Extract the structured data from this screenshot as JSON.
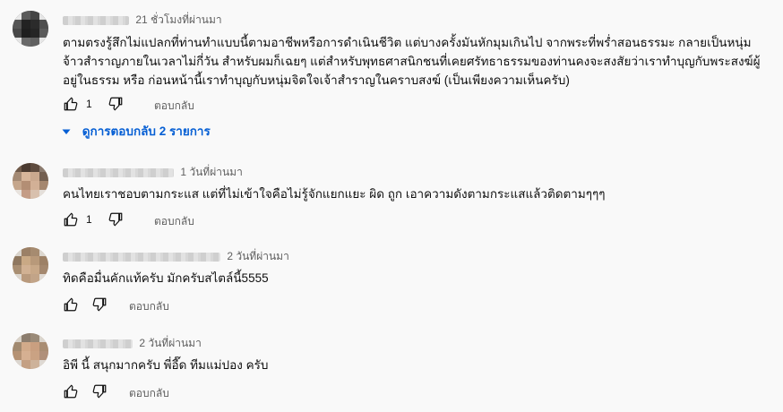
{
  "comments": [
    {
      "time": "21 ชั่วโมงที่ผ่านมา",
      "text": "ตามตรงรู้สึกไม่แปลกที่ท่านทำแบบนี้ตามอาชีพหรือการดำเนินชีวิต  แต่บางครั้งมันหักมุมเกินไป  จากพระที่พร่ำสอนธรรมะ กลายเป็นหนุ่มจ้าวสำราญภายในเวลาไม่กี่วัน  สำหรับผมก็เฉยๆ  แต่สำหรับพุทธศาสนิกชนที่เคยศรัทธาธรรมของท่านคงจะสงสัยว่าเราทำบุญกับพระสงฆ์ผู้อยู่ในธรรม หรือ ก่อนหน้านี้เราทำบุญกับหนุ่มจิตใจเจ้าสำราญในคราบสงฆ์  (เป็นเพียงความเห็นครับ)",
      "likes": "1",
      "reply_label": "ตอบกลับ"
    },
    {
      "time": "1 วันที่ผ่านมา",
      "text": "คนไทยเราชอบตามกระแส แต่ที่ไม่เข้าใจคือไม่รู้จักแยกแยะ ผิด ถูก เอาความดังตามกระแสแล้วติดตามๆๆๆ",
      "likes": "1",
      "reply_label": "ตอบกลับ"
    },
    {
      "time": "2 วันที่ผ่านมา",
      "text": "ทิดคือมื่นคักแท้ครับ มักครับสไตล์นี้5555",
      "likes": "",
      "reply_label": "ตอบกลับ"
    },
    {
      "time": "2 วันที่ผ่านมา",
      "text": "อิพี นี้ สนุกมากครับ พี่อี๊ด ทีมแม่ปอง ครับ",
      "likes": "",
      "reply_label": "ตอบกลับ"
    }
  ],
  "replies_toggle": {
    "label": "ดูการตอบกลับ 2 รายการ",
    "icon": "chevron-down-icon",
    "color": "#065fd4"
  },
  "icons": {
    "like": "thumbs-up-icon",
    "dislike": "thumbs-down-icon"
  }
}
